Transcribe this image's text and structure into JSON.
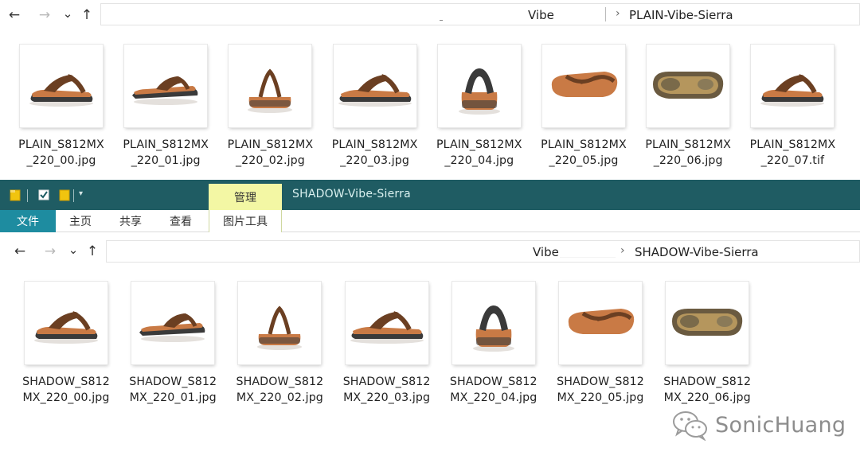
{
  "top_window": {
    "nav": {
      "back": "←",
      "forward": "→",
      "recent": "⌄",
      "up": "↑"
    },
    "address": {
      "segment1": "Vibe",
      "segment2": "PLAIN-Vibe-Sierra",
      "chevron": "›"
    },
    "files": [
      {
        "line1": "PLAIN_S812MX",
        "line2": "_220_00.jpg",
        "view": "side-left"
      },
      {
        "line1": "PLAIN_S812MX",
        "line2": "_220_01.jpg",
        "view": "side-right"
      },
      {
        "line1": "PLAIN_S812MX",
        "line2": "_220_02.jpg",
        "view": "back"
      },
      {
        "line1": "PLAIN_S812MX",
        "line2": "_220_03.jpg",
        "view": "side-left-long"
      },
      {
        "line1": "PLAIN_S812MX",
        "line2": "_220_04.jpg",
        "view": "front"
      },
      {
        "line1": "PLAIN_S812MX",
        "line2": "_220_05.jpg",
        "view": "top"
      },
      {
        "line1": "PLAIN_S812MX",
        "line2": "_220_06.jpg",
        "view": "sole"
      },
      {
        "line1": "PLAIN_S812MX",
        "line2": "_220_07.tif",
        "view": "side-left"
      }
    ]
  },
  "second_window": {
    "title": "SHADOW-Vibe-Sierra",
    "context_tab": "管理",
    "ribbon_tabs": {
      "file": "文件",
      "home": "主页",
      "share": "共享",
      "view": "查看",
      "picture_tools": "图片工具"
    },
    "nav": {
      "back": "←",
      "forward": "→",
      "recent": "⌄",
      "up": "↑"
    },
    "address": {
      "segment1": "Vibe",
      "segment2": "SHADOW-Vibe-Sierra",
      "chevron": "›"
    },
    "files": [
      {
        "line1": "SHADOW_S812",
        "line2": "MX_220_00.jpg",
        "view": "side-left"
      },
      {
        "line1": "SHADOW_S812",
        "line2": "MX_220_01.jpg",
        "view": "side-right"
      },
      {
        "line1": "SHADOW_S812",
        "line2": "MX_220_02.jpg",
        "view": "back"
      },
      {
        "line1": "SHADOW_S812",
        "line2": "MX_220_03.jpg",
        "view": "side-left-long"
      },
      {
        "line1": "SHADOW_S812",
        "line2": "MX_220_04.jpg",
        "view": "front"
      },
      {
        "line1": "SHADOW_S812",
        "line2": "MX_220_05.jpg",
        "view": "top"
      },
      {
        "line1": "SHADOW_S812",
        "line2": "MX_220_06.jpg",
        "view": "sole"
      }
    ]
  },
  "watermark": {
    "text": "SonicHuang",
    "icon": "wechat-icon"
  },
  "colors": {
    "title_bar": "#1f5c63",
    "file_tab": "#1e8ca0",
    "manage_tab": "#f3f7a4",
    "sandal_strap": "#6b3f22",
    "sandal_footbed": "#c97a45",
    "sandal_sole": "#3a3a3a"
  }
}
